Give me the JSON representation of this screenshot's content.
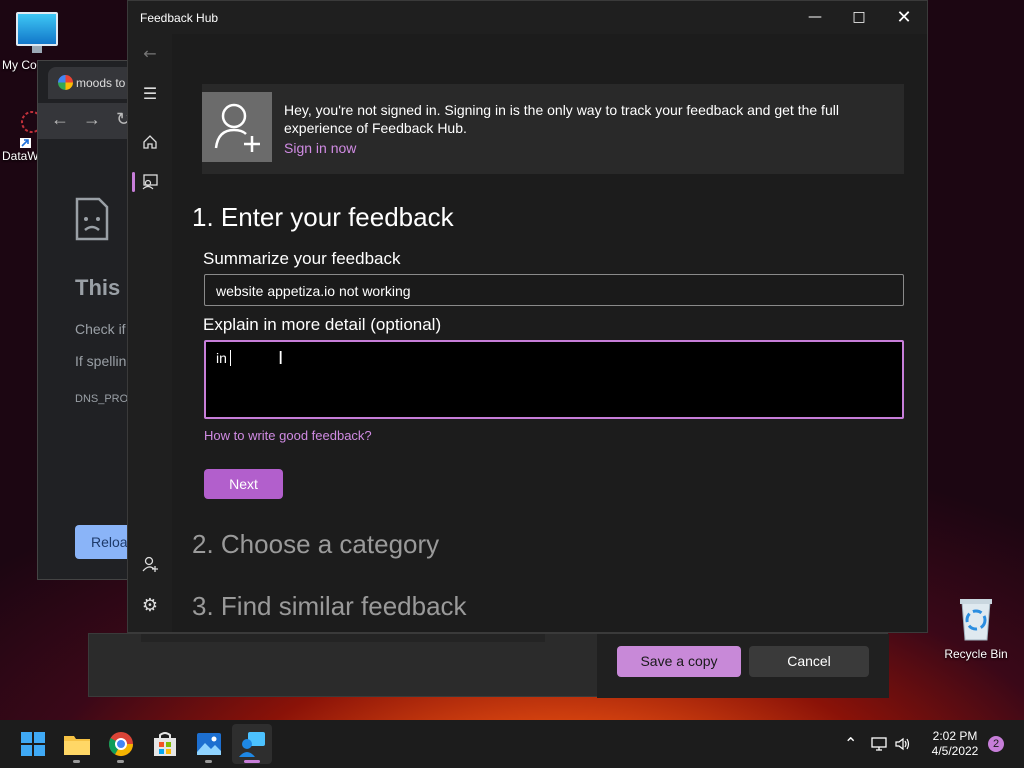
{
  "desktop": {
    "icons": [
      {
        "label": "My Co"
      },
      {
        "label": "DataW"
      },
      {
        "label": "Recycle Bin"
      }
    ]
  },
  "browser": {
    "tab_title": "moods to",
    "heading": "This s",
    "line1": "Check if",
    "line2": "If spellin",
    "error_code": "DNS_PRO",
    "reload_label": "Reloa"
  },
  "background_dialog": {
    "save_copy_label": "Save a copy",
    "cancel_label": "Cancel"
  },
  "feedback_hub": {
    "window_title": "Feedback Hub",
    "signin_banner": {
      "message": "Hey, you're not signed in. Signing in is the only way to track your feedback and get the full experience of Feedback Hub.",
      "link_label": "Sign in now"
    },
    "step1_title": "1. Enter your feedback",
    "summary_label": "Summarize your feedback",
    "summary_value": "website appetiza.io not working",
    "detail_label": "Explain in more detail (optional)",
    "detail_value": "in",
    "help_link": "How to write good feedback?",
    "next_label": "Next",
    "step2_title": "2. Choose a category",
    "step3_title": "3. Find similar feedback"
  },
  "taskbar": {
    "time": "2:02 PM",
    "date": "4/5/2022",
    "notification_count": "2"
  },
  "colors": {
    "accent": "#c889d8",
    "link": "#d08be3",
    "window_bg": "#1f1f1f"
  }
}
